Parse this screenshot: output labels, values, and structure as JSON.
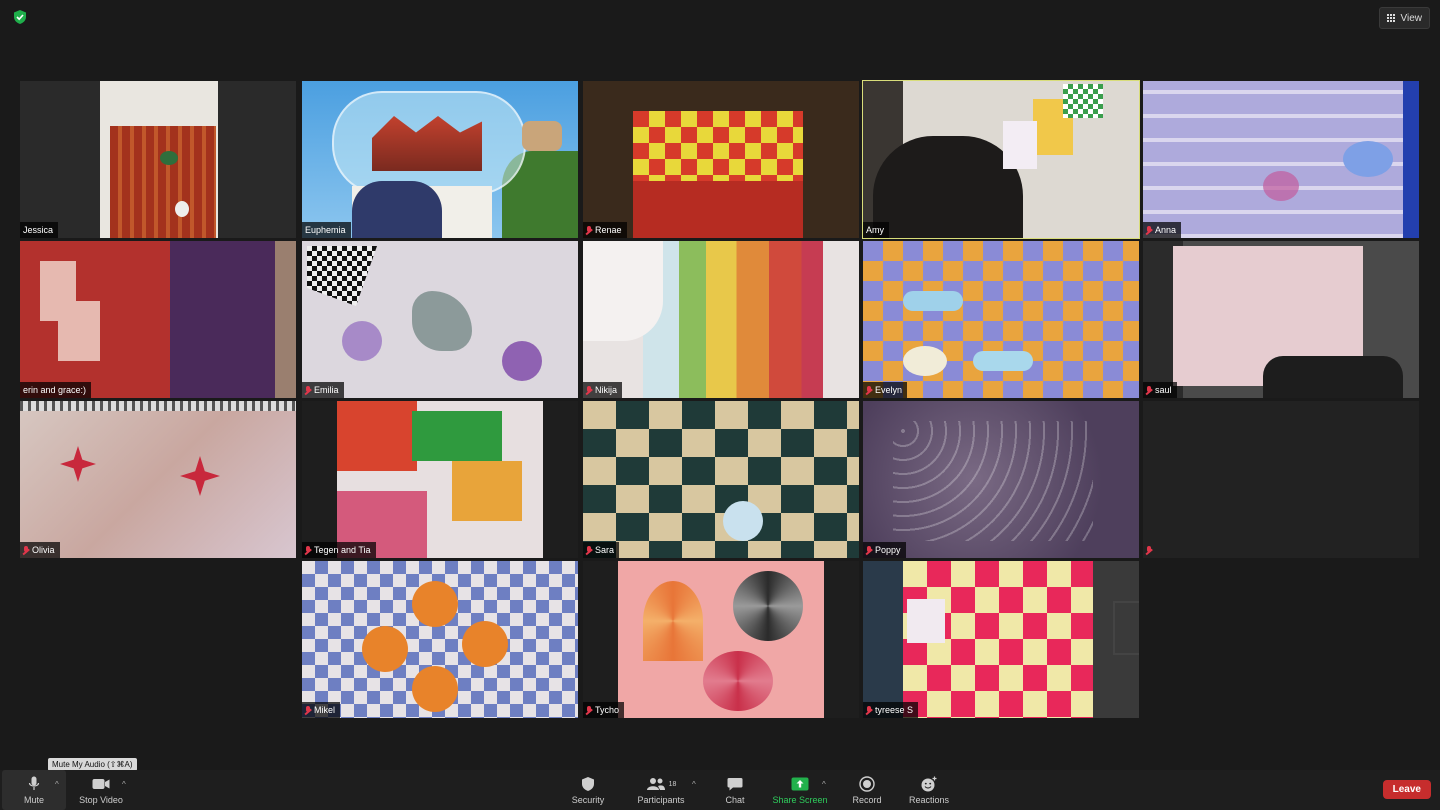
{
  "header": {
    "view_label": "View"
  },
  "participants": [
    {
      "name": "Jessica",
      "muted": false
    },
    {
      "name": "Euphemia",
      "muted": false
    },
    {
      "name": "Renae",
      "muted": true
    },
    {
      "name": "Amy",
      "muted": false,
      "active_speaker": true
    },
    {
      "name": "Anna",
      "muted": true
    },
    {
      "name": "erin and grace:)",
      "muted": false
    },
    {
      "name": "Emilia",
      "muted": true
    },
    {
      "name": "Nikija",
      "muted": false
    },
    {
      "name": "Evelyn",
      "muted": true
    },
    {
      "name": "saul",
      "muted": true
    },
    {
      "name": "Olivia",
      "muted": true
    },
    {
      "name": "Tegen and Tia",
      "muted": true
    },
    {
      "name": "Sara",
      "muted": true
    },
    {
      "name": "Poppy",
      "muted": true
    },
    {
      "name": "",
      "muted": true
    },
    {
      "name": "Mikel",
      "muted": true
    },
    {
      "name": "Tycho",
      "muted": true
    },
    {
      "name": "tyreese S",
      "muted": true
    }
  ],
  "tooltip": "Mute My Audio (⇧⌘A)",
  "toolbar": {
    "mute": "Mute",
    "stop_video": "Stop Video",
    "security": "Security",
    "participants": "Participants",
    "participants_count": "18",
    "chat": "Chat",
    "share_screen": "Share Screen",
    "record": "Record",
    "reactions": "Reactions",
    "leave": "Leave"
  },
  "colors": {
    "accent_green": "#22b14c",
    "leave_red": "#c62d2d",
    "active_speaker": "#d8dd7a",
    "muted_red": "#e0364a"
  }
}
